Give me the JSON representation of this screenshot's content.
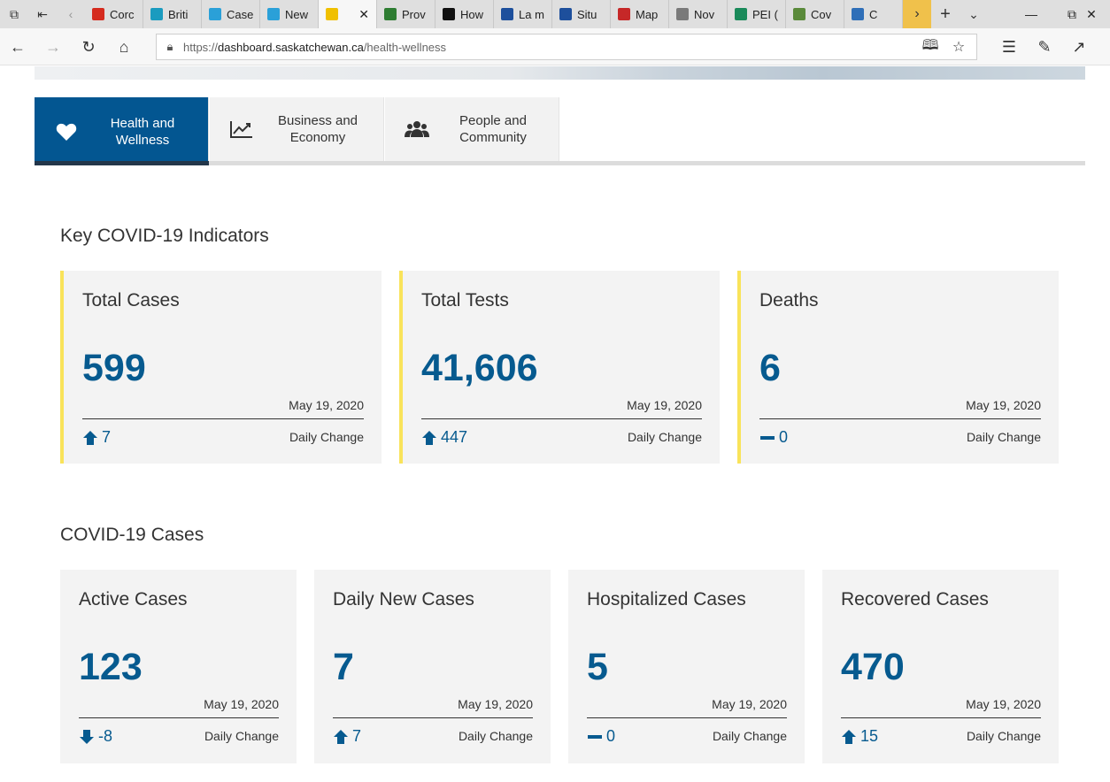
{
  "browser": {
    "tabs": [
      {
        "label": "Corc",
        "color": "#d52b1e"
      },
      {
        "label": "Briti",
        "color": "#1a9bbf"
      },
      {
        "label": "Case",
        "color": "#2aa0d8"
      },
      {
        "label": "New",
        "color": "#2aa0d8"
      },
      {
        "label": "",
        "color": "#f0c000"
      },
      {
        "label": "Prov",
        "color": "#2e7d32"
      },
      {
        "label": "How",
        "color": "#111111"
      },
      {
        "label": "La m",
        "color": "#1d4f9c"
      },
      {
        "label": "Situ",
        "color": "#1d4f9c"
      },
      {
        "label": "Map",
        "color": "#c62828"
      },
      {
        "label": "Nov",
        "color": "#7a7a7a"
      },
      {
        "label": "PEI (",
        "color": "#1a8a5a"
      },
      {
        "label": "Cov",
        "color": "#5a8a3a"
      },
      {
        "label": "C",
        "color": "#2f6fb8"
      }
    ],
    "url_prefix": "https://",
    "url_host": "dashboard.saskatchewan.ca",
    "url_path": "/health-wellness"
  },
  "topic_tabs": [
    {
      "label": "Health and Wellness",
      "icon": "heart-icon"
    },
    {
      "label": "Business and Economy",
      "icon": "chart-line-icon"
    },
    {
      "label": "People and Community",
      "icon": "users-icon"
    }
  ],
  "key_indicators": {
    "title": "Key COVID-19 Indicators",
    "cards": [
      {
        "title": "Total Cases",
        "value": "599",
        "date": "May 19, 2020",
        "change": "7",
        "direction": "up",
        "change_label": "Daily Change"
      },
      {
        "title": "Total Tests",
        "value": "41,606",
        "date": "May 19, 2020",
        "change": "447",
        "direction": "up",
        "change_label": "Daily Change"
      },
      {
        "title": "Deaths",
        "value": "6",
        "date": "May 19, 2020",
        "change": "0",
        "direction": "flat",
        "change_label": "Daily Change"
      }
    ]
  },
  "covid_cases": {
    "title": "COVID-19 Cases",
    "cards": [
      {
        "title": "Active Cases",
        "value": "123",
        "date": "May 19, 2020",
        "change": "-8",
        "direction": "down",
        "change_label": "Daily Change"
      },
      {
        "title": "Daily New Cases",
        "value": "7",
        "date": "May 19, 2020",
        "change": "7",
        "direction": "up",
        "change_label": "Daily Change"
      },
      {
        "title": "Hospitalized Cases",
        "value": "5",
        "date": "May 19, 2020",
        "change": "0",
        "direction": "flat",
        "change_label": "Daily Change"
      },
      {
        "title": "Recovered Cases",
        "value": "470",
        "date": "May 19, 2020",
        "change": "15",
        "direction": "up",
        "change_label": "Daily Change"
      }
    ]
  },
  "colors": {
    "accent": "#035691",
    "value": "#065a8f",
    "card_border": "#f9e35a"
  }
}
